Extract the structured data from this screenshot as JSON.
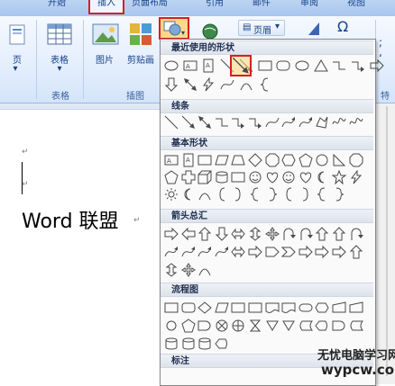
{
  "tabs": {
    "start": "开始",
    "insert": "插入",
    "page_layout": "页面布局",
    "references": "引用",
    "mailings": "邮件",
    "review": "审阅",
    "view": "视图"
  },
  "ribbon": {
    "page_btn": "页",
    "table_btn": "表格",
    "picture_btn": "图片",
    "clipart_btn": "剪贴画",
    "header_btn": "页眉",
    "omega": "Ω",
    "group_table": "表格",
    "group_illustrations": "插图",
    "group_special": "特"
  },
  "document": {
    "text": "Word 联盟",
    "paragraph_mark": "↵"
  },
  "dropdown": {
    "sections": [
      "最近使用的形状",
      "线条",
      "基本形状",
      "箭头总汇",
      "流程图",
      "标注"
    ]
  },
  "watermark": {
    "line1": "无忧电脑学习网",
    "line2": "wypcw.com"
  }
}
